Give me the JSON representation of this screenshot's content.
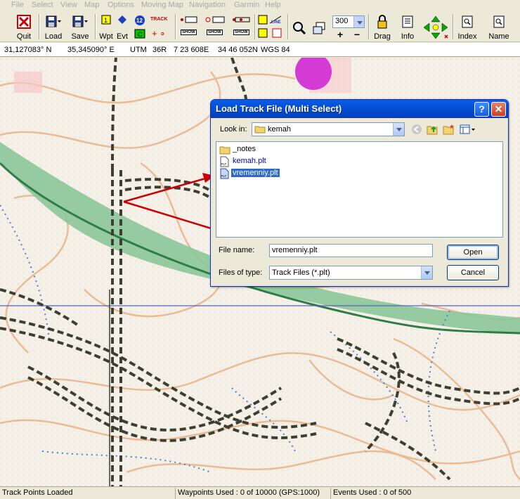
{
  "menu": {
    "items": [
      "File",
      "Select",
      "View",
      "Map",
      "Options",
      "Moving Map",
      "Navigation",
      "Garmin",
      "Help"
    ]
  },
  "toolbar": {
    "quit": "Quit",
    "load": "Load",
    "save": "Save",
    "wpt": "Wpt",
    "evt": "Evt",
    "track_label": "TRACK",
    "show_label": "SHOW",
    "line_label": "LINE",
    "zoom_value": "300",
    "drag": "Drag",
    "info": "Info",
    "index": "Index",
    "name": "Name",
    "plus": "+",
    "minus": "−"
  },
  "coords": {
    "lat": "31,127083° N",
    "lon": "35,345090° E",
    "utm_label": "UTM",
    "zone": "36R",
    "easting": "7 23 608E",
    "northing": "34 46 052N",
    "datum": "WGS 84"
  },
  "dialog": {
    "title": "Load Track File (Multi Select)",
    "help_glyph": "?",
    "close_glyph": "✕",
    "look_in_label": "Look in:",
    "look_in_value": "kemah",
    "files": [
      {
        "name": "_notes",
        "kind": "folder"
      },
      {
        "name": "kemah.plt",
        "kind": "plt"
      },
      {
        "name": "vremenniy.plt",
        "kind": "plt",
        "selected": true
      }
    ],
    "file_name_label": "File name:",
    "file_name_value": "vremenniy.plt",
    "files_of_type_label": "Files of type:",
    "files_of_type_value": "Track Files (*.plt)",
    "open_button": "Open",
    "cancel_button": "Cancel"
  },
  "status": {
    "message": "Track Points Loaded",
    "waypoints": "Waypoints Used : 0 of 10000  (GPS:1000)",
    "events": "Events Used : 0 of 500"
  },
  "colors": {
    "arrow": "#cc0000",
    "selection": "#316ac5",
    "titlebar": "#0450d6"
  }
}
